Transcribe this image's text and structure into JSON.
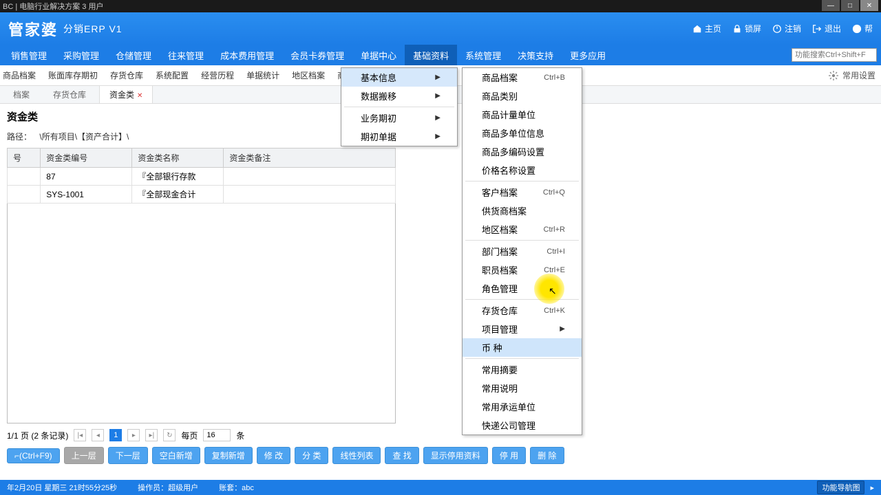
{
  "titlebar": {
    "text": "BC  | 电脑行业解决方案 3 用户"
  },
  "header": {
    "logo": "管家婆",
    "logo_sub": "分销ERP V1",
    "links": [
      "主页",
      "锁屏",
      "注销",
      "退出",
      "帮"
    ]
  },
  "mainmenu": {
    "items": [
      "销售管理",
      "采购管理",
      "仓储管理",
      "往来管理",
      "成本费用管理",
      "会员卡券管理",
      "单据中心",
      "基础资料",
      "系统管理",
      "决策支持",
      "更多应用"
    ],
    "active_index": 7,
    "search_placeholder": "功能搜索Ctrl+Shift+F"
  },
  "toolbar": {
    "items": [
      "商品档案",
      "账面库存期初",
      "存货仓库",
      "系统配置",
      "经营历程",
      "单据统计",
      "地区档案",
      "商品"
    ],
    "settings": "常用设置"
  },
  "tabs": {
    "items": [
      "档案",
      "存货仓库",
      "资金类"
    ],
    "active_index": 2
  },
  "page": {
    "title": "资金类",
    "path_label": "路径：",
    "path": "\\所有项目\\【资产合计】\\"
  },
  "table": {
    "headers": [
      "号",
      "资金类编号",
      "资金类名称",
      "资金类备注"
    ],
    "rows": [
      {
        "num": "",
        "code": "87",
        "name": "『全部银行存款",
        "note": ""
      },
      {
        "num": "",
        "code": "SYS-1001",
        "name": "『全部现金合计",
        "note": ""
      }
    ]
  },
  "pager": {
    "info": "1/1 页 (2 条记录)",
    "page": "1",
    "refresh": "↻",
    "per_label": "每页",
    "per_value": "16",
    "per_suffix": "条"
  },
  "actions": {
    "hotkey": "⌐(Ctrl+F9)",
    "up": "上一层",
    "down": "下一层",
    "items": [
      "空白新增",
      "复制新增",
      "修 改",
      "分 类",
      "线性列表",
      "查 找",
      "显示停用资料",
      "停 用",
      "删 除"
    ]
  },
  "statusbar": {
    "date": "年2月20日 星期三  21时55分25秒",
    "operator_label": "操作员：",
    "operator": "超级用户",
    "account_label": "账套：",
    "account": "abc",
    "nav": "功能导航图"
  },
  "submenu1": {
    "items": [
      {
        "label": "基本信息",
        "arrow": true,
        "hover": true
      },
      {
        "label": "数据搬移",
        "arrow": true
      },
      {
        "sep": true
      },
      {
        "label": "业务期初",
        "arrow": true
      },
      {
        "label": "期初单据",
        "arrow": true
      }
    ]
  },
  "submenu2": {
    "items": [
      {
        "label": "商品档案",
        "shortcut": "Ctrl+B"
      },
      {
        "label": "商品类别"
      },
      {
        "label": "商品计量单位"
      },
      {
        "label": "商品多单位信息"
      },
      {
        "label": "商品多编码设置"
      },
      {
        "label": "价格名称设置"
      },
      {
        "sep": true
      },
      {
        "label": "客户档案",
        "shortcut": "Ctrl+Q"
      },
      {
        "label": "供货商档案"
      },
      {
        "label": "地区档案",
        "shortcut": "Ctrl+R"
      },
      {
        "sep": true
      },
      {
        "label": "部门档案",
        "shortcut": "Ctrl+I"
      },
      {
        "label": "职员档案",
        "shortcut": "Ctrl+E"
      },
      {
        "label": "角色管理"
      },
      {
        "sep": true
      },
      {
        "label": "存货仓库",
        "shortcut": "Ctrl+K"
      },
      {
        "label": "项目管理",
        "arrow": true
      },
      {
        "label": "币   种",
        "highlight": true
      },
      {
        "sep": true
      },
      {
        "label": "常用摘要"
      },
      {
        "label": "常用说明"
      },
      {
        "label": "常用承运单位"
      },
      {
        "label": "快递公司管理"
      }
    ]
  }
}
